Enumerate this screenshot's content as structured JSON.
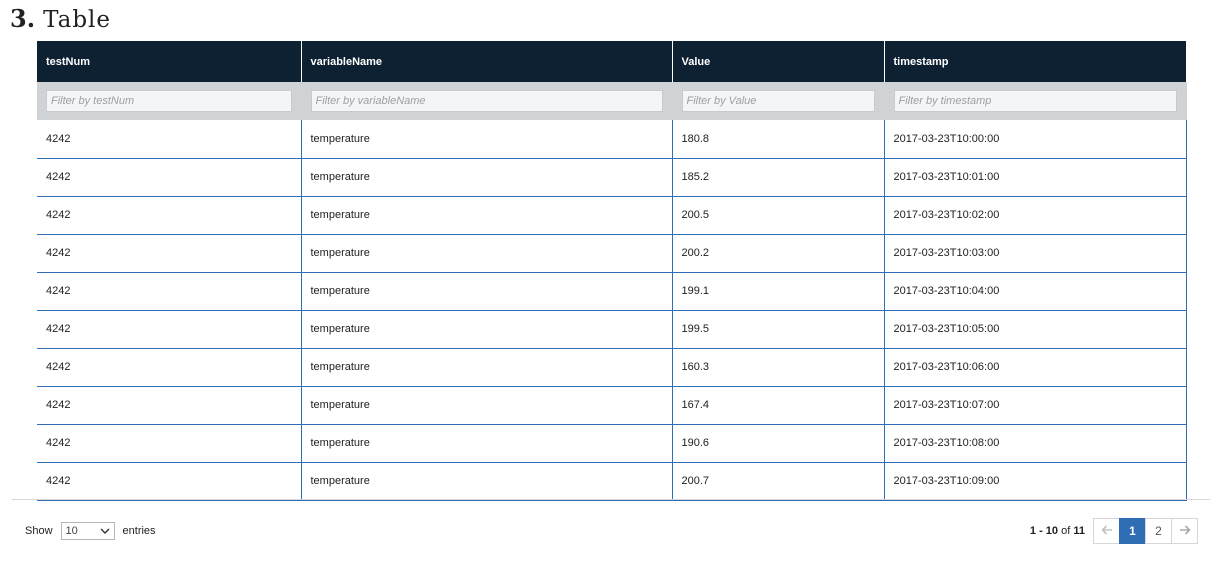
{
  "section": {
    "number": "3.",
    "title": "Table"
  },
  "table": {
    "columns": [
      "testNum",
      "variableName",
      "Value",
      "timestamp"
    ],
    "filters": [
      "Filter by testNum",
      "Filter by variableName",
      "Filter by Value",
      "Filter by timestamp"
    ],
    "rows": [
      [
        "4242",
        "temperature",
        "180.8",
        "2017-03-23T10:00:00"
      ],
      [
        "4242",
        "temperature",
        "185.2",
        "2017-03-23T10:01:00"
      ],
      [
        "4242",
        "temperature",
        "200.5",
        "2017-03-23T10:02:00"
      ],
      [
        "4242",
        "temperature",
        "200.2",
        "2017-03-23T10:03:00"
      ],
      [
        "4242",
        "temperature",
        "199.1",
        "2017-03-23T10:04:00"
      ],
      [
        "4242",
        "temperature",
        "199.5",
        "2017-03-23T10:05:00"
      ],
      [
        "4242",
        "temperature",
        "160.3",
        "2017-03-23T10:06:00"
      ],
      [
        "4242",
        "temperature",
        "167.4",
        "2017-03-23T10:07:00"
      ],
      [
        "4242",
        "temperature",
        "190.6",
        "2017-03-23T10:08:00"
      ],
      [
        "4242",
        "temperature",
        "200.7",
        "2017-03-23T10:09:00"
      ]
    ]
  },
  "footer": {
    "show_label": "Show",
    "entries_value": "10",
    "entries_label": "entries",
    "range": "1 - 10",
    "of_label": "of",
    "total": "11",
    "pages": [
      "1",
      "2"
    ],
    "prev_icon": "arrow-left-icon",
    "next_icon": "arrow-right-icon"
  },
  "colors": {
    "header_bg": "#0d2133",
    "row_border": "#2f6db5",
    "active_page": "#2f6db5"
  }
}
